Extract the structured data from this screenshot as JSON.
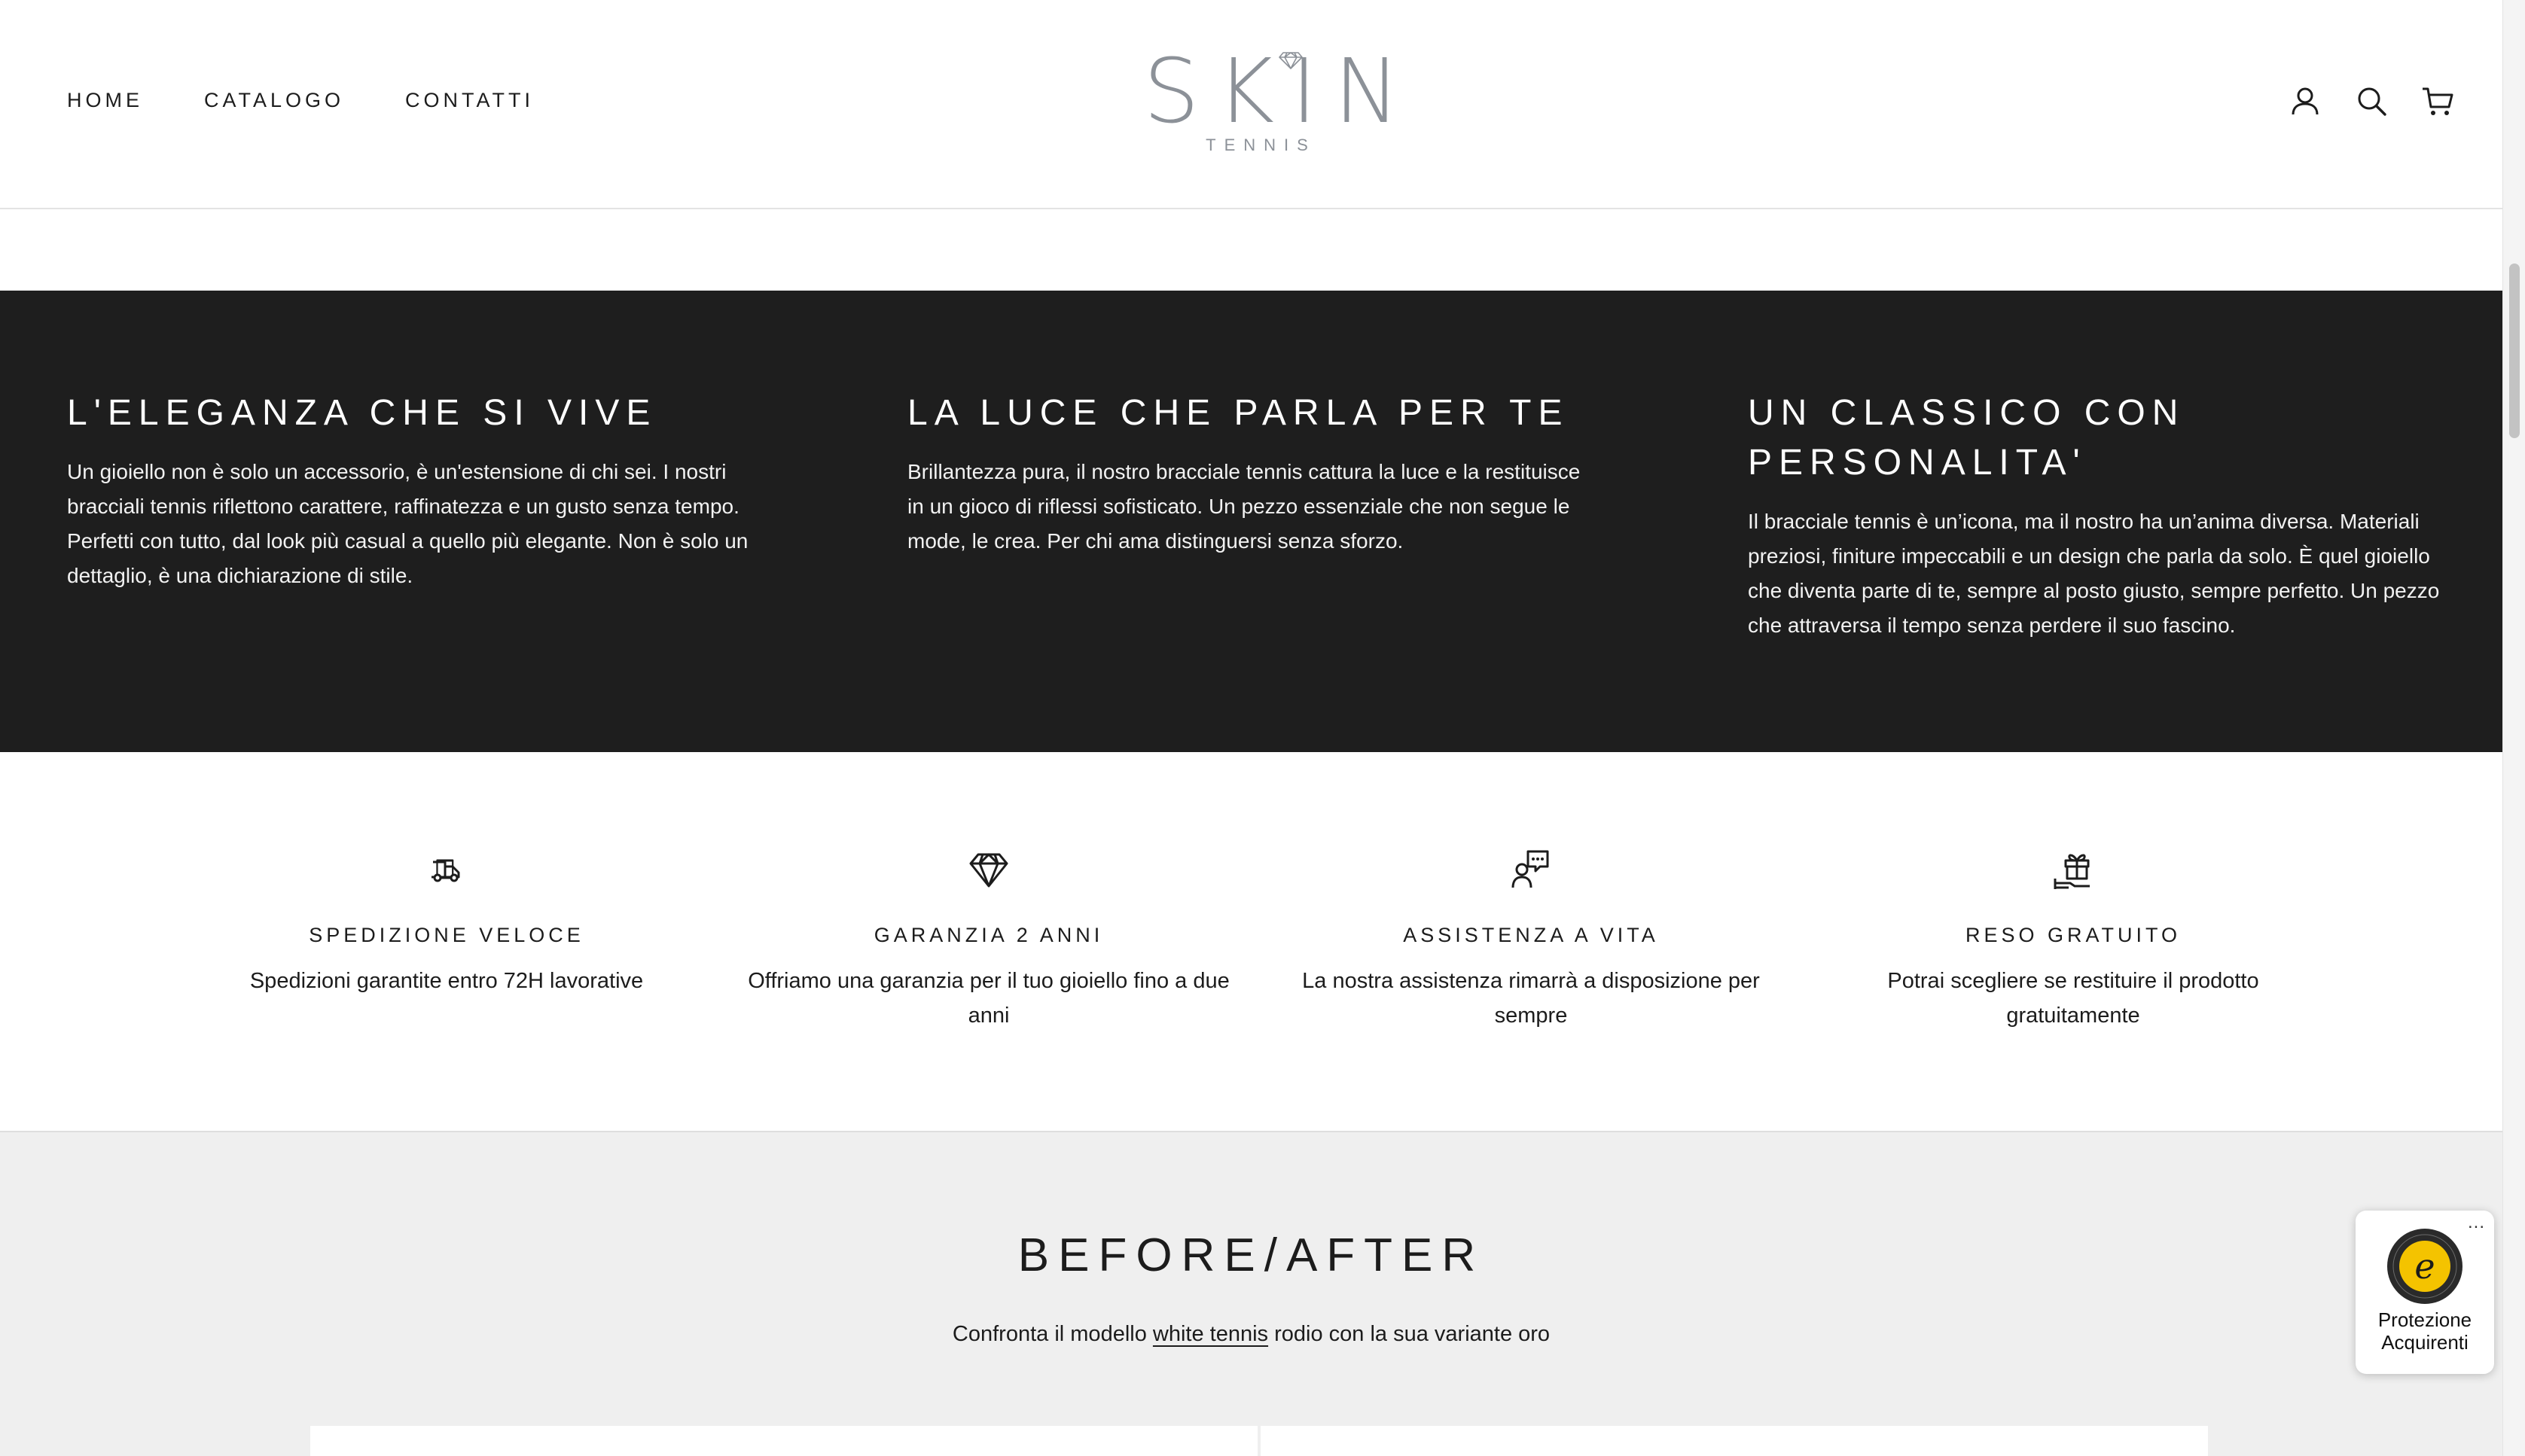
{
  "header": {
    "nav": [
      {
        "label": "HOME"
      },
      {
        "label": "CATALOGO"
      },
      {
        "label": "CONTATTI"
      }
    ],
    "logo": {
      "main": "SKIN",
      "sub": "TENNIS"
    },
    "icons": [
      "account-icon",
      "search-icon",
      "cart-icon"
    ]
  },
  "highlights": [
    {
      "title": "L'ELEGANZA CHE SI VIVE",
      "text": "Un gioiello non è solo un accessorio, è un'estensione di chi sei. I nostri bracciali tennis riflettono carattere, raffinatezza e un gusto senza tempo. Perfetti con tutto, dal look più casual a quello più elegante. Non è solo un dettaglio, è una dichiarazione di stile."
    },
    {
      "title": "LA LUCE CHE PARLA PER TE",
      "text": "Brillantezza pura, il nostro bracciale tennis cattura la luce e la restituisce in un gioco di riflessi sofisticato. Un pezzo essenziale che non segue le mode, le crea. Per chi ama distinguersi senza sforzo."
    },
    {
      "title": "UN CLASSICO CON PERSONALITA'",
      "text": "Il bracciale tennis è un’icona, ma il nostro ha un’anima diversa. Materiali preziosi, finiture impeccabili e un design che parla da solo. È quel gioiello che diventa parte di te, sempre al posto giusto, sempre perfetto. Un pezzo che attraversa il tempo senza perdere il suo fascino."
    }
  ],
  "features": [
    {
      "icon": "delivery-truck-icon",
      "title": "SPEDIZIONE VELOCE",
      "text": "Spedizioni garantite entro 72H lavorative"
    },
    {
      "icon": "diamond-icon",
      "title": "GARANZIA 2 ANNI",
      "text": "Offriamo una garanzia per il tuo gioiello fino a due anni"
    },
    {
      "icon": "support-chat-icon",
      "title": "ASSISTENZA A VITA",
      "text": "La nostra assistenza rimarrà a disposizione per sempre"
    },
    {
      "icon": "gift-return-icon",
      "title": "RESO GRATUITO",
      "text": "Potrai scegliere se restituire il prodotto gratuitamente"
    }
  ],
  "before_after": {
    "title": "BEFORE/AFTER",
    "sub_prefix": "Confronta il modello ",
    "sub_link": "white tennis",
    "sub_suffix": " rodio con la sua variante oro"
  },
  "trusted_badge": {
    "line1": "Protezione",
    "line2": "Acquirenti",
    "dots": "...",
    "seal_letter": "e"
  },
  "colors": {
    "dark_band": "#1e1e1e",
    "logo_gray": "#8c9198",
    "text": "#1c1c1c",
    "section_gray": "#efefef",
    "seal_gold": "#f4c300"
  }
}
